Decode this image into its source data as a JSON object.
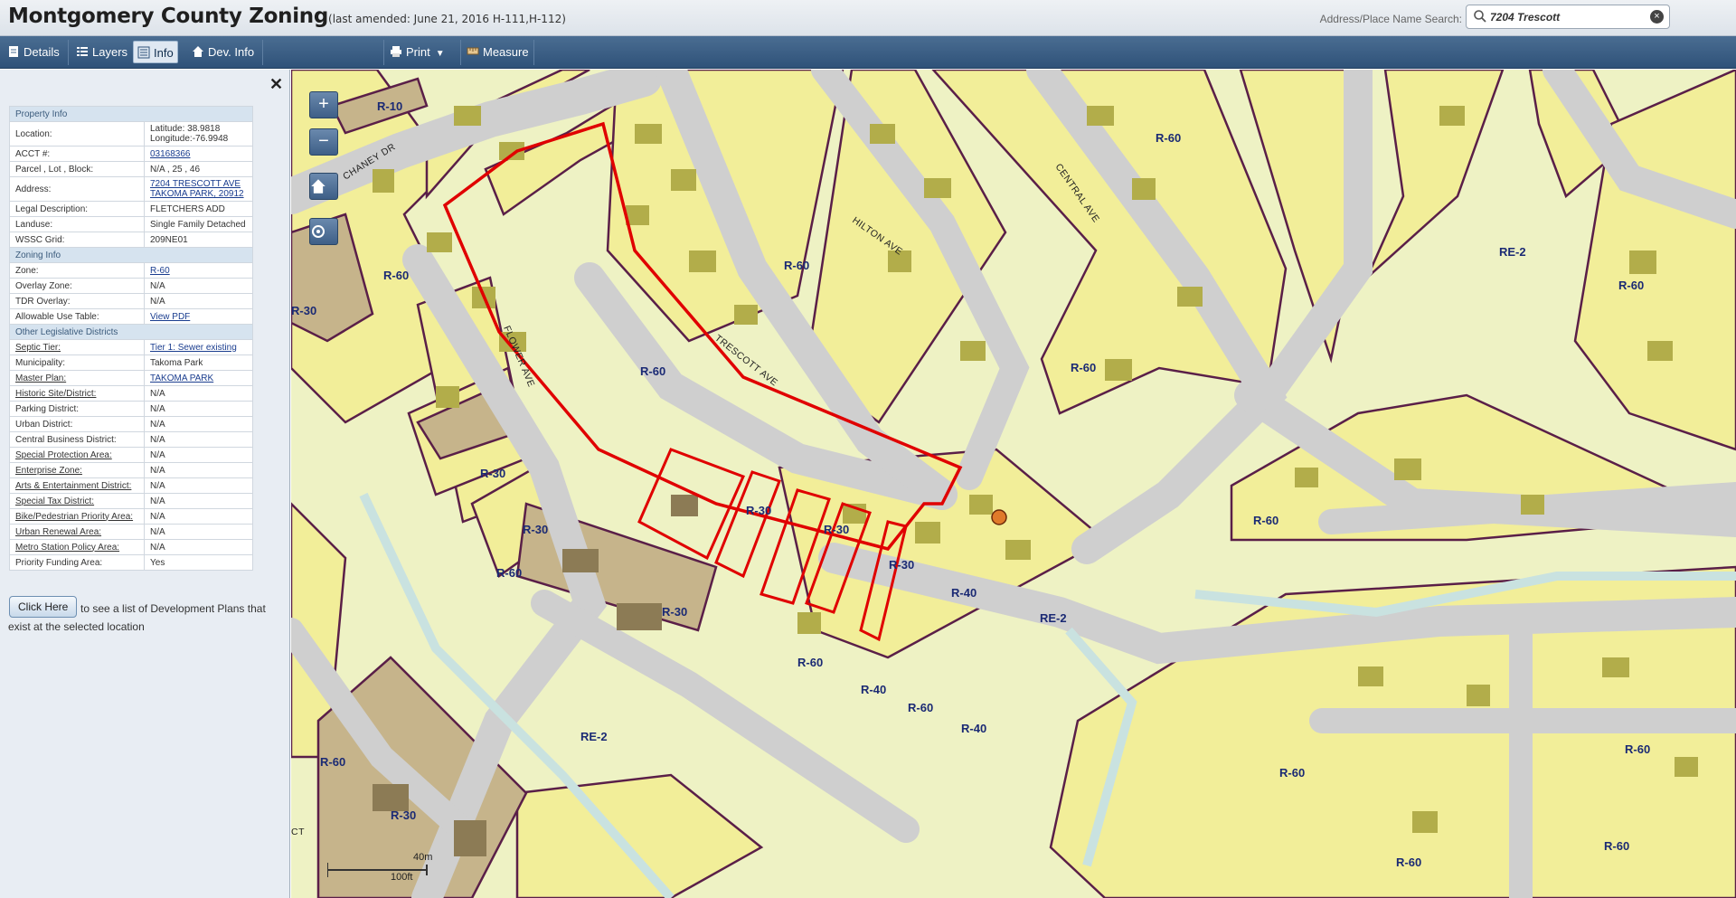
{
  "header": {
    "title": "Montgomery County Zoning",
    "amended": "(last amended: June 21, 2016 H-111,H-112)",
    "search_label": "Address/Place Name Search:",
    "search_value": "7204 Trescott"
  },
  "toolbar": {
    "details": "Details",
    "layers": "Layers",
    "info": "Info",
    "dev_info": "Dev. Info",
    "print": "Print",
    "measure": "Measure"
  },
  "panel": {
    "sections": {
      "property": "Property Info",
      "zoning": "Zoning Info",
      "other": "Other Legislative Districts"
    },
    "rows": {
      "location_k": "Location:",
      "location_v1": "Latitude: 38.9818",
      "location_v2": "Longitude:-76.9948",
      "acct_k": "ACCT #:",
      "acct_v": "03168366",
      "parcel_k": "Parcel , Lot , Block:",
      "parcel_v": "N/A , 25 , 46",
      "address_k": "Address:",
      "address_v1": "7204 TRESCOTT AVE",
      "address_v2": "TAKOMA PARK, 20912",
      "legal_k": "Legal Description:",
      "legal_v": "FLETCHERS ADD",
      "landuse_k": "Landuse:",
      "landuse_v": "Single Family Detached",
      "wssc_k": "WSSC Grid:",
      "wssc_v": "209NE01",
      "zone_k": "Zone:",
      "zone_v": "R-60",
      "overlay_k": "Overlay Zone:",
      "overlay_v": "N/A",
      "tdr_k": "TDR Overlay:",
      "tdr_v": "N/A",
      "use_k": "Allowable Use Table:",
      "use_v": "View PDF",
      "septic_k": "Septic Tier:",
      "septic_v": "Tier 1: Sewer existing",
      "muni_k": "Municipality:",
      "muni_v": "Takoma Park",
      "master_k": "Master Plan:",
      "master_v": "TAKOMA PARK",
      "historic_k": "Historic Site/District:",
      "historic_v": "N/A",
      "parking_k": "Parking District:",
      "parking_v": "N/A",
      "urban_k": "Urban District:",
      "urban_v": "N/A",
      "cbd_k": "Central Business District:",
      "cbd_v": "N/A",
      "spa_k": "Special Protection Area:",
      "spa_v": "N/A",
      "ez_k": "Enterprise Zone:",
      "ez_v": "N/A",
      "ae_k": "Arts & Entertainment District:",
      "ae_v": "N/A",
      "std_k": "Special Tax District:",
      "std_v": "N/A",
      "bike_k": "Bike/Pedestrian Priority Area:",
      "bike_v": "N/A",
      "renew_k": "Urban Renewal Area:",
      "renew_v": "N/A",
      "metro_k": "Metro Station Policy Area:",
      "metro_v": "N/A",
      "pfa_k": "Priority Funding Area:",
      "pfa_v": "Yes"
    },
    "click_button": "Click Here",
    "click_text": "to see a list of Development Plans that exist at the selected location"
  },
  "map": {
    "streets": {
      "chaney": "CHANEY DR",
      "central": "CENTRAL AVE",
      "hilton": "HILTON AVE",
      "trescott": "TRESCOTT AVE",
      "flower": "FLOWER AVE",
      "ct": "CT"
    },
    "zones": {
      "r10": "R-10",
      "r30": "R-30",
      "r40": "R-40",
      "r60": "R-60",
      "re2": "RE-2"
    },
    "scale": {
      "metric": "40m",
      "imperial": "100ft"
    },
    "colors": {
      "residential": "#f2ee99",
      "commercial": "#c6b48b",
      "parkland": "#eef2c4",
      "road": "#cfcfcf",
      "highlight": "#e00000",
      "zone_border": "#5a1f48"
    }
  }
}
